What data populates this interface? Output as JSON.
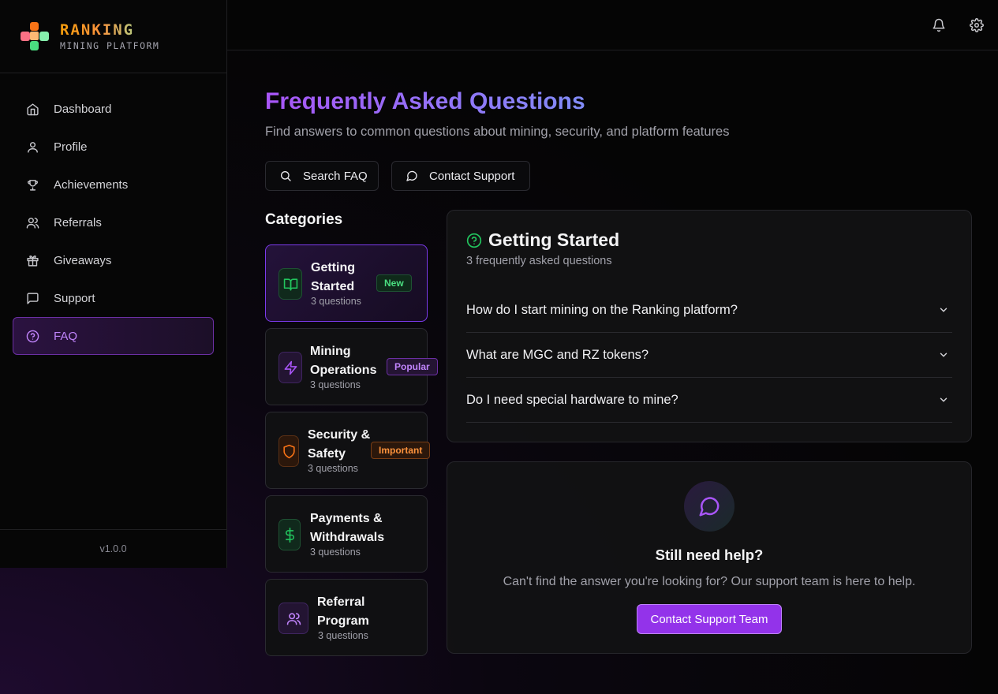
{
  "brand": {
    "title": "RANKING",
    "subtitle": "MINING PLATFORM"
  },
  "sidebar": {
    "items": [
      {
        "label": "Dashboard",
        "icon": "home-icon",
        "active": false
      },
      {
        "label": "Profile",
        "icon": "user-icon",
        "active": false
      },
      {
        "label": "Achievements",
        "icon": "trophy-icon",
        "active": false
      },
      {
        "label": "Referrals",
        "icon": "users-icon",
        "active": false
      },
      {
        "label": "Giveaways",
        "icon": "gift-icon",
        "active": false
      },
      {
        "label": "Support",
        "icon": "message-square-icon",
        "active": false
      },
      {
        "label": "FAQ",
        "icon": "help-circle-icon",
        "active": true
      }
    ],
    "version": "v1.0.0"
  },
  "header": {
    "icons": [
      "bell-icon",
      "settings-icon"
    ]
  },
  "page": {
    "title": "Frequently Asked Questions",
    "subtitle": "Find answers to common questions about mining, security, and platform features",
    "search_button": "Search FAQ",
    "contact_button": "Contact Support"
  },
  "categories": {
    "heading": "Categories",
    "items": [
      {
        "title_line1": "Getting",
        "title_line2": "Started",
        "count": "3 questions",
        "badge": "New",
        "icon": "book-open-icon",
        "color": "#22c55e"
      },
      {
        "title_line1": "Mining",
        "title_line2": "Operations",
        "count": "3 questions",
        "badge": "Popular",
        "icon": "zap-icon",
        "color": "#a855f7"
      },
      {
        "title_line1": "Security &",
        "title_line2": "Safety",
        "count": "3 questions",
        "badge": "Important",
        "icon": "shield-icon",
        "color": "#f97316"
      },
      {
        "title_line1": "Payments &",
        "title_line2": "Withdrawals",
        "count": "3 questions",
        "badge": "",
        "icon": "dollar-sign-icon",
        "color": "#22c55e"
      },
      {
        "title_line1": "Referral",
        "title_line2": "Program",
        "count": "3 questions",
        "badge": "",
        "icon": "users-icon",
        "color": "#c084fc"
      }
    ]
  },
  "faq_panel": {
    "title": "Getting Started",
    "subtitle": "3 frequently asked questions",
    "questions": [
      "How do I start mining on the Ranking platform?",
      "What are MGC and RZ tokens?",
      "Do I need special hardware to mine?"
    ]
  },
  "help_panel": {
    "title": "Still need help?",
    "text": "Can't find the answer you're looking for? Our support team is here to help.",
    "button": "Contact Support Team"
  },
  "colors": {
    "accent": "#a855f7",
    "accent_button": "#9333ea",
    "success": "#22c55e",
    "warning": "#f97316"
  }
}
